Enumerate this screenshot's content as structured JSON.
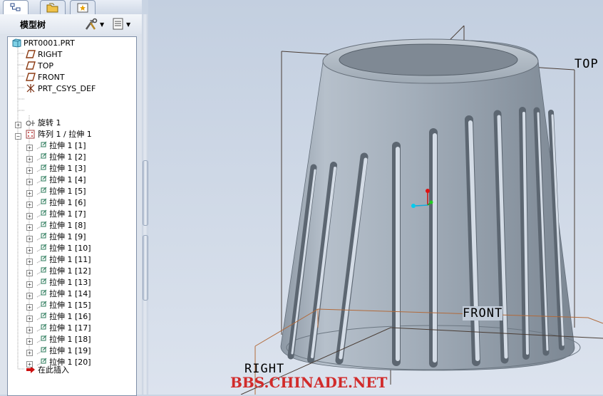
{
  "navigator": {
    "tabs": [
      {
        "name": "model-tree-tab",
        "icon": "model-tree-icon"
      },
      {
        "name": "folder-browser-tab",
        "icon": "folder-icon"
      },
      {
        "name": "favorites-tab",
        "icon": "star-icon"
      }
    ],
    "title": "模型树",
    "settings_icon": "tools-icon",
    "show_icon": "list-icon",
    "dropdown_arrow": "▼"
  },
  "tree": {
    "root": "PRT0001.PRT",
    "items": [
      {
        "label": "RIGHT",
        "icon": "datum-plane-icon"
      },
      {
        "label": "TOP",
        "icon": "datum-plane-icon"
      },
      {
        "label": "FRONT",
        "icon": "datum-plane-icon"
      },
      {
        "label": "PRT_CSYS_DEF",
        "icon": "csys-icon"
      },
      {
        "label": "旋转 1",
        "icon": "revolve-icon"
      },
      {
        "label": "阵列 1 / 拉伸 1",
        "icon": "pattern-icon"
      }
    ],
    "pattern_children": [
      "拉伸 1 [1]",
      "拉伸 1 [2]",
      "拉伸 1 [3]",
      "拉伸 1 [4]",
      "拉伸 1 [5]",
      "拉伸 1 [6]",
      "拉伸 1 [7]",
      "拉伸 1 [8]",
      "拉伸 1 [9]",
      "拉伸 1 [10]",
      "拉伸 1 [11]",
      "拉伸 1 [12]",
      "拉伸 1 [13]",
      "拉伸 1 [14]",
      "拉伸 1 [15]",
      "拉伸 1 [16]",
      "拉伸 1 [17]",
      "拉伸 1 [18]",
      "拉伸 1 [19]",
      "拉伸 1 [20]"
    ],
    "insert_here": "在此插入"
  },
  "viewport": {
    "datum_labels": {
      "top": "TOP",
      "front": "FRONT",
      "right": "RIGHT"
    },
    "watermark": "BBS.CHINADE.NET"
  },
  "colors": {
    "model_body": "#9aa6b2",
    "datum_line": "#4a3d35",
    "datum_orange": "#b26a3a",
    "watermark": "#d12b2b",
    "insert_arrow": "#cc1111"
  }
}
